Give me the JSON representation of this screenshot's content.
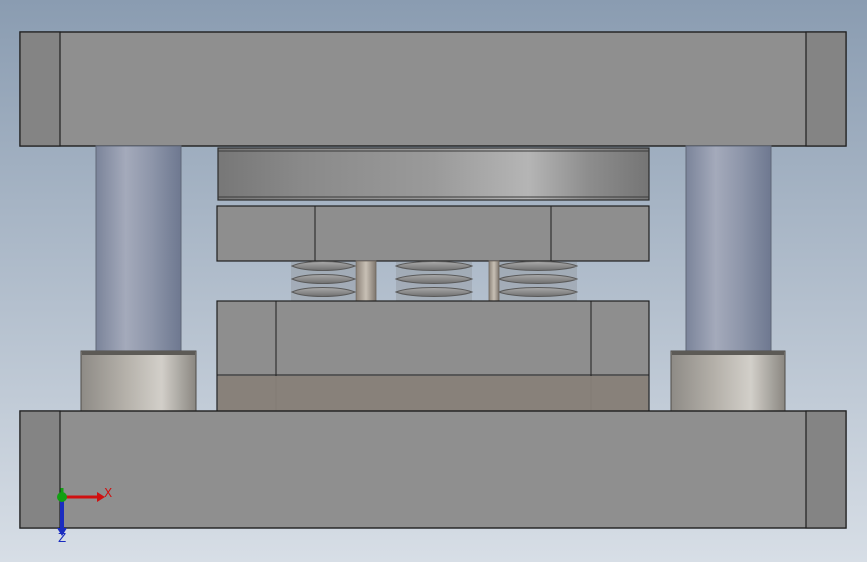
{
  "viewport": {
    "background_top": "#8A9CB1",
    "background_bottom": "#D7DEE6"
  },
  "colors": {
    "plate_gray": "#8F8F8F",
    "plate_edge": "#1F1F1F",
    "plate_dark": "#7D7D7D",
    "plate_light": "#A3A3A3",
    "pillar_blue": "#8D97AD",
    "bushing_tan": "#B7B2AA",
    "spring_gray": "#8E8E8E",
    "axis_x": "#D01010",
    "axis_y": "#12A012",
    "axis_z": "#1A2CC0"
  },
  "triad": {
    "x_label": "X",
    "z_label": "Z",
    "x_icon": "x-axis-arrow-icon",
    "y_icon": "y-axis-dot-icon",
    "z_icon": "z-axis-arrow-icon"
  }
}
